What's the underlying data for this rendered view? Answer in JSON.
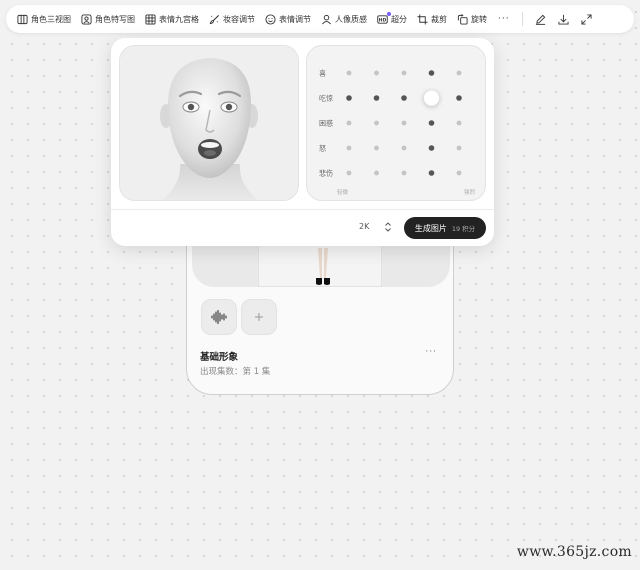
{
  "toolbar": {
    "items": [
      {
        "label": "角色三视图",
        "icon": "columns-icon"
      },
      {
        "label": "角色特写图",
        "icon": "portrait-icon"
      },
      {
        "label": "表情九宫格",
        "icon": "grid-icon"
      },
      {
        "label": "妆容调节",
        "icon": "brush-icon"
      },
      {
        "label": "表情调节",
        "icon": "smile-icon"
      },
      {
        "label": "人像质感",
        "icon": "person-icon"
      },
      {
        "label": "超分",
        "icon": "hd-icon"
      },
      {
        "label": "裁剪",
        "icon": "crop-icon"
      },
      {
        "label": "旋转",
        "icon": "rotate-icon"
      }
    ],
    "more_label": "···",
    "right_icons": [
      "edit-icon",
      "download-icon",
      "expand-icon"
    ]
  },
  "expression_panel": {
    "rows": [
      {
        "label": "喜",
        "dots": [
          1,
          1,
          1,
          2,
          1
        ]
      },
      {
        "label": "吃惊",
        "dots": [
          2,
          2,
          2,
          3,
          2
        ]
      },
      {
        "label": "困惑",
        "dots": [
          1,
          1,
          1,
          2,
          1
        ]
      },
      {
        "label": "怒",
        "dots": [
          1,
          1,
          1,
          2,
          1
        ]
      },
      {
        "label": "悲伤",
        "dots": [
          1,
          1,
          1,
          2,
          1
        ]
      }
    ],
    "scale_min_label": "轻微",
    "scale_max_label": "强烈",
    "selected": {
      "row": "吃惊",
      "level": 4
    }
  },
  "resolution": {
    "value": "2K"
  },
  "generate_button": {
    "label": "生成图片",
    "cost": "19 积分"
  },
  "character_card": {
    "name": "基础形象",
    "meta": "出现集数：第 1 集",
    "more_label": "···"
  },
  "watermark": "www.365jz.com",
  "colors": {
    "accent_dot": "#7a5cff",
    "primary_button": "#222222",
    "dot_light": "#c4c4c4",
    "dot_dark": "#555555"
  }
}
